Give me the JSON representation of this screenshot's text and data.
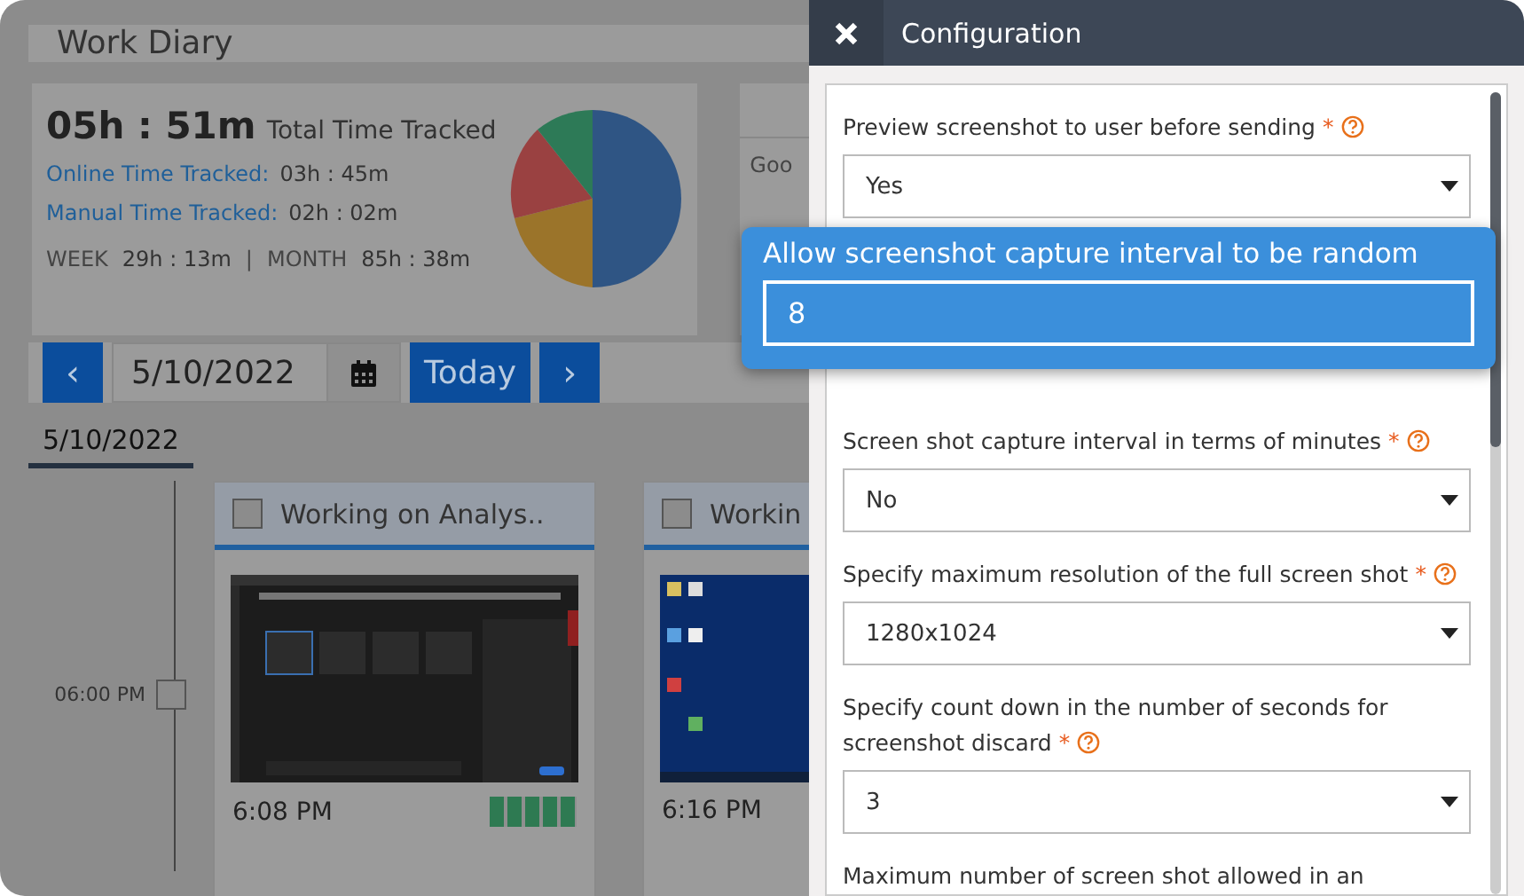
{
  "page": {
    "title": "Work Diary"
  },
  "summary": {
    "total": "05h : 51m",
    "total_label": "Total Time Tracked",
    "online_label": "Online Time Tracked:",
    "online": "03h : 45m",
    "manual_label": "Manual Time Tracked:",
    "manual": "02h : 02m",
    "week_label": "WEEK",
    "week": "29h : 13m",
    "separator": "|",
    "month_label": "MONTH",
    "month": "85h : 38m"
  },
  "side_card": {
    "text": "Goo"
  },
  "date_nav": {
    "prev": "‹",
    "date": "5/10/2022",
    "today": "Today",
    "next": "›"
  },
  "day_tab": {
    "label": "5/10/2022",
    "selected": true
  },
  "timeline": {
    "time": "06:00 PM",
    "checked": false
  },
  "shots": [
    {
      "title": "Working on Analys..",
      "checked": false,
      "time": "6:08 PM",
      "level": 1,
      "kind": "app"
    },
    {
      "title": "Workin",
      "checked": false,
      "time": "6:16 PM",
      "kind": "desktop"
    }
  ],
  "config": {
    "title": "Configuration",
    "fields": [
      {
        "label": "Preview screenshot to user before sending",
        "required_mark": "*",
        "value": "Yes"
      },
      {
        "label": "Screen shot capture interval in terms of minutes",
        "required_mark": "*",
        "value": "No"
      },
      {
        "label": "Specify maximum resolution of the full screen shot",
        "required_mark": "*",
        "value": "1280x1024"
      },
      {
        "label": "Specify count down in the number of seconds for screenshot discard",
        "required_mark": "*",
        "value": "3"
      },
      {
        "label": "Maximum number of screen shot allowed in an"
      }
    ]
  },
  "highlight": {
    "label": "Allow screenshot capture interval to be random",
    "value": "8"
  }
}
